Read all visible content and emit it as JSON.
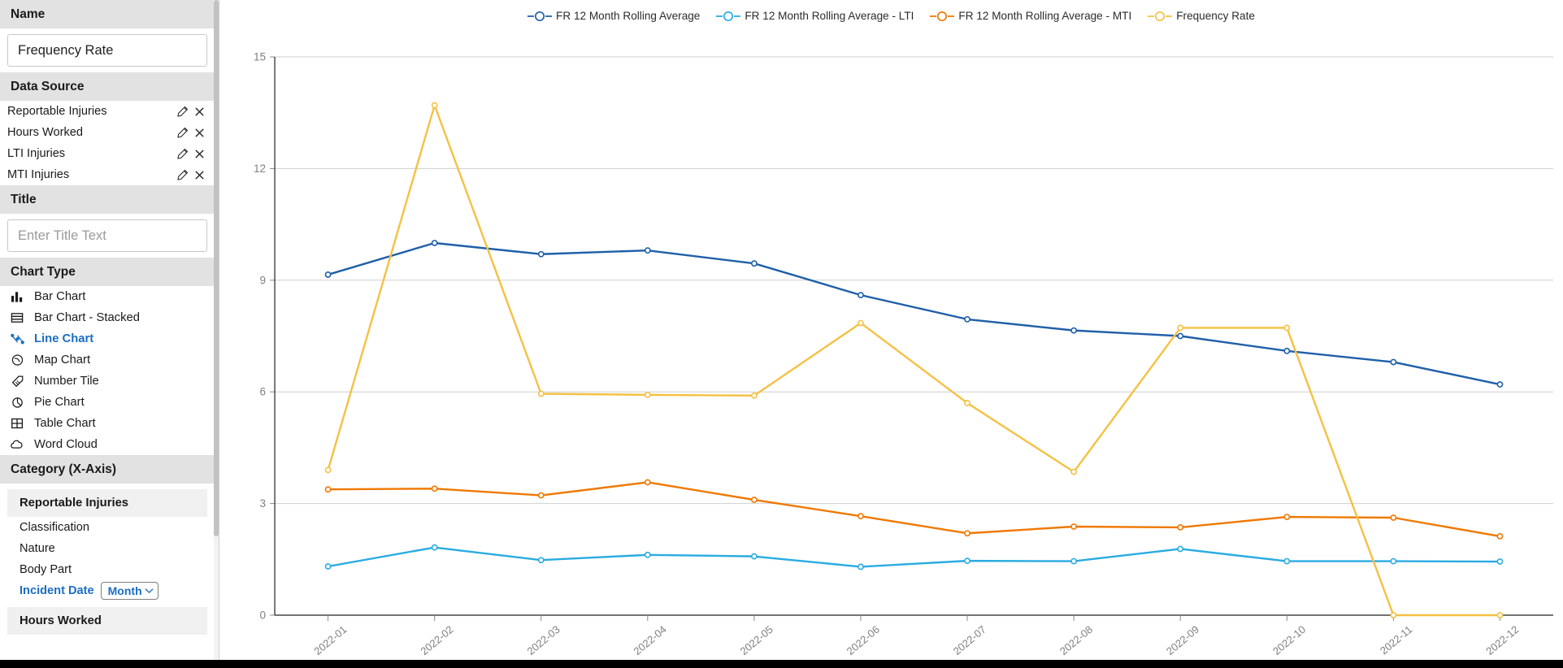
{
  "sidebar": {
    "name_section": {
      "header": "Name",
      "value": "Frequency Rate"
    },
    "data_source": {
      "header": "Data Source",
      "items": [
        {
          "label": "Reportable Injuries"
        },
        {
          "label": "Hours Worked"
        },
        {
          "label": "LTI Injuries"
        },
        {
          "label": "MTI Injuries"
        }
      ]
    },
    "title_section": {
      "header": "Title",
      "value": "",
      "placeholder": "Enter Title Text"
    },
    "chart_type": {
      "header": "Chart Type",
      "items": [
        {
          "label": "Bar Chart",
          "icon": "bar-chart-icon",
          "active": false
        },
        {
          "label": "Bar Chart - Stacked",
          "icon": "bar-chart-stacked-icon",
          "active": false
        },
        {
          "label": "Line Chart",
          "icon": "line-chart-icon",
          "active": true
        },
        {
          "label": "Map Chart",
          "icon": "map-chart-icon",
          "active": false
        },
        {
          "label": "Number Tile",
          "icon": "number-tile-icon",
          "active": false
        },
        {
          "label": "Pie Chart",
          "icon": "pie-chart-icon",
          "active": false
        },
        {
          "label": "Table Chart",
          "icon": "table-chart-icon",
          "active": false
        },
        {
          "label": "Word Cloud",
          "icon": "word-cloud-icon",
          "active": false
        }
      ]
    },
    "category": {
      "header": "Category (X-Axis)",
      "groups": [
        {
          "name": "Reportable Injuries",
          "fields": [
            {
              "label": "Classification",
              "active": false,
              "pill": null
            },
            {
              "label": "Nature",
              "active": false,
              "pill": null
            },
            {
              "label": "Body Part",
              "active": false,
              "pill": null
            },
            {
              "label": "Incident Date",
              "active": true,
              "pill": "Month"
            }
          ]
        },
        {
          "name": "Hours Worked",
          "fields": []
        }
      ]
    }
  },
  "chart_data": {
    "type": "line",
    "title": "",
    "xlabel": "",
    "ylabel": "",
    "ylim": [
      0,
      15
    ],
    "yticks": [
      0,
      3,
      6,
      9,
      12,
      15
    ],
    "grid": true,
    "legend_position": "top",
    "categories": [
      "2022-01",
      "2022-02",
      "2022-03",
      "2022-04",
      "2022-05",
      "2022-06",
      "2022-07",
      "2022-08",
      "2022-09",
      "2022-10",
      "2022-11",
      "2022-12"
    ],
    "series": [
      {
        "name": "FR 12 Month Rolling Average",
        "color": "#1F5FA9",
        "values": [
          9.15,
          10.0,
          9.7,
          9.8,
          9.45,
          8.6,
          7.95,
          7.65,
          7.5,
          7.1,
          6.8,
          6.2
        ]
      },
      {
        "name": "FR 12 Month Rolling Average - LTI",
        "color": "#29ABE2",
        "values": [
          1.31,
          1.82,
          1.48,
          1.62,
          1.58,
          1.3,
          1.46,
          1.45,
          1.78,
          1.45,
          1.45,
          1.44
        ]
      },
      {
        "name": "FR 12 Month Rolling Average - MTI",
        "color": "#F07800",
        "values": [
          3.38,
          3.4,
          3.22,
          3.57,
          3.1,
          2.66,
          2.2,
          2.38,
          2.36,
          2.64,
          2.62,
          2.12
        ]
      },
      {
        "name": "Frequency Rate",
        "color": "#F5C143",
        "values": [
          3.9,
          13.7,
          5.95,
          5.92,
          5.9,
          7.85,
          5.7,
          3.85,
          7.72,
          7.72,
          0,
          0
        ]
      }
    ]
  }
}
